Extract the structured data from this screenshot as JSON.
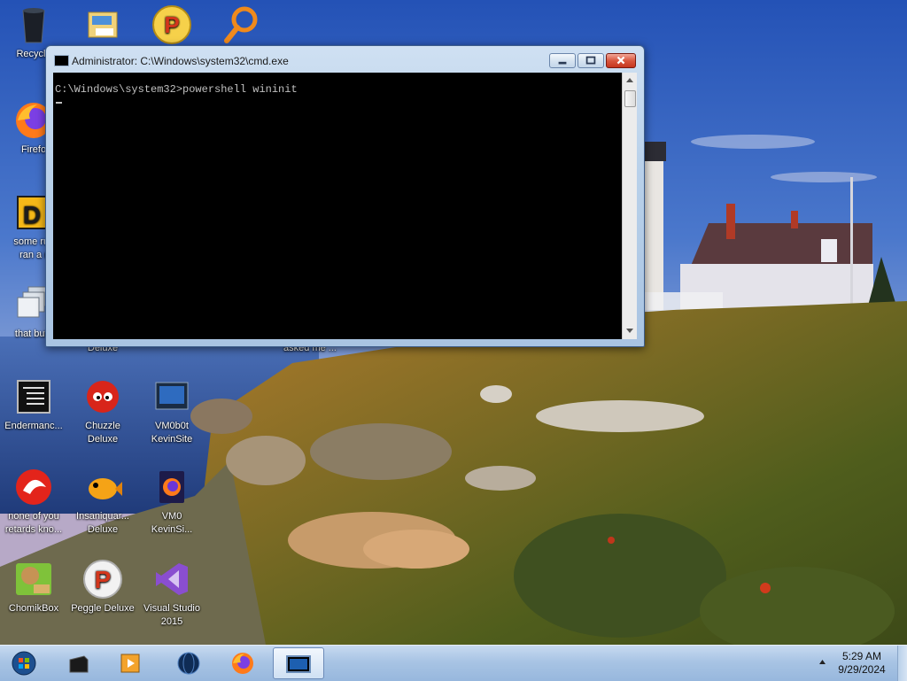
{
  "desktop": {
    "icons": [
      {
        "id": "recycle",
        "label_line1": "Recycle",
        "label_line2": "",
        "icon": "recycle-bin-icon"
      },
      {
        "id": "mail",
        "label_line1": "",
        "label_line2": "",
        "icon": "mail-app-icon"
      },
      {
        "id": "peggle-top",
        "label_line1": "",
        "label_line2": "",
        "icon": "peggle-icon"
      },
      {
        "id": "search",
        "label_line1": "",
        "label_line2": "",
        "icon": "magnifier-icon"
      },
      {
        "id": "firefox",
        "label_line1": "Firefo",
        "label_line2": "",
        "icon": "firefox-icon"
      },
      {
        "id": "some",
        "label_line1": "some rus",
        "label_line2": "ran a r",
        "icon": "app-icon"
      },
      {
        "id": "thatbut",
        "label_line1": "that but i",
        "label_line2": "",
        "icon": "windows-stack-icon"
      },
      {
        "id": "deluxe-hidden",
        "label_line1": "Deluxe",
        "label_line2": "",
        "icon": ""
      },
      {
        "id": "asked",
        "label_line1": "asked me ...",
        "label_line2": "",
        "icon": ""
      },
      {
        "id": "endermanc",
        "label_line1": "Endermanc...",
        "label_line2": "",
        "icon": "console-icon"
      },
      {
        "id": "chuzzle",
        "label_line1": "Chuzzle",
        "label_line2": "Deluxe",
        "icon": "chuzzle-icon"
      },
      {
        "id": "vm0b0t",
        "label_line1": "VM0b0t",
        "label_line2": "KevinSite",
        "icon": "vm-screen-icon"
      },
      {
        "id": "noneofyou",
        "label_line1": "none of you",
        "label_line2": "retards kno...",
        "icon": "red-app-icon"
      },
      {
        "id": "insaniquarium",
        "label_line1": "Insaniquar...",
        "label_line2": "Deluxe",
        "icon": "fish-icon"
      },
      {
        "id": "vm0",
        "label_line1": "VM0",
        "label_line2": "KevinSi...",
        "icon": "firefox-dark-icon"
      },
      {
        "id": "chomikbox",
        "label_line1": "ChomikBox",
        "label_line2": "",
        "icon": "hamster-box-icon"
      },
      {
        "id": "peggle",
        "label_line1": "Peggle Deluxe",
        "label_line2": "",
        "icon": "peggle-icon"
      },
      {
        "id": "vs2015",
        "label_line1": "Visual Studio",
        "label_line2": "2015",
        "icon": "visual-studio-icon"
      }
    ]
  },
  "cmd_window": {
    "title": "Administrator: C:\\Windows\\system32\\cmd.exe",
    "console_line": "C:\\Windows\\system32>powershell wininit",
    "buttons": {
      "minimize": "minimize-icon",
      "maximize": "maximize-icon",
      "close": "close-icon"
    }
  },
  "taskbar": {
    "items": [
      "start-orb-icon",
      "terminal-icon",
      "media-player-icon",
      "globe-icon",
      "firefox-icon",
      "cmd-icon"
    ],
    "clock": {
      "time": "5:29 AM",
      "date": "9/29/2024"
    }
  },
  "colors": {
    "console_bg": "#000000",
    "console_text": "#c0c0c0",
    "taskbar": "#a8c4e4"
  }
}
